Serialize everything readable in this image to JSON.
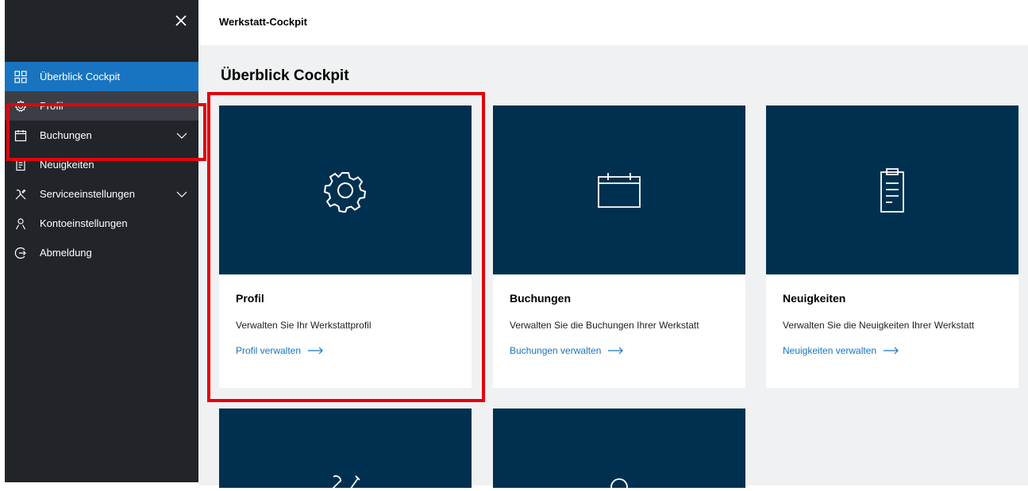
{
  "topbar": {
    "title": "Werkstatt-Cockpit"
  },
  "sidebar": {
    "items": [
      {
        "label": "Überblick Cockpit",
        "icon": "grid-icon"
      },
      {
        "label": "Profil",
        "icon": "gear-icon"
      },
      {
        "label": "Buchungen",
        "icon": "calendar-icon"
      },
      {
        "label": "Neuigkeiten",
        "icon": "document-icon"
      },
      {
        "label": "Serviceeinstellungen",
        "icon": "tools-icon"
      },
      {
        "label": "Kontoeinstellungen",
        "icon": "person-icon"
      },
      {
        "label": "Abmeldung",
        "icon": "logout-icon"
      }
    ]
  },
  "main": {
    "title": "Überblick Cockpit",
    "cards": [
      {
        "title": "Profil",
        "desc": "Verwalten Sie Ihr Werkstattprofil",
        "link": "Profil verwalten",
        "icon": "gear-icon"
      },
      {
        "title": "Buchungen",
        "desc": "Verwalten Sie die Buchungen Ihrer Werkstatt",
        "link": "Buchungen verwalten",
        "icon": "calendar-icon"
      },
      {
        "title": "Neuigkeiten",
        "desc": "Verwalten Sie die Neuigkeiten Ihrer Werkstatt",
        "link": "Neuigkeiten verwalten",
        "icon": "clipboard-icon"
      }
    ]
  },
  "colors": {
    "sidebar": "#212429",
    "active": "#1874c1",
    "hero": "#00304f",
    "highlight": "#e4000b",
    "background": "#eff1f2"
  }
}
